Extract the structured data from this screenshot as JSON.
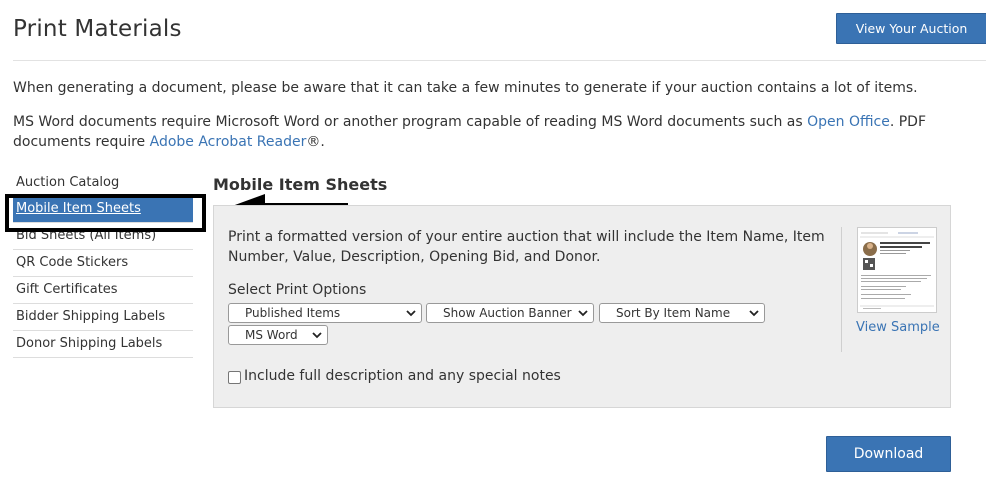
{
  "header": {
    "title": "Print Materials",
    "view_auction_label": "View Your Auction"
  },
  "intro": {
    "line1": "When generating a document, please be aware that it can take a few minutes to generate if your auction contains a lot of items.",
    "line2_pre": "MS Word documents require Microsoft Word or another program capable of reading MS Word documents such as ",
    "open_office_link": "Open Office",
    "line2_mid": ". PDF documents require ",
    "acrobat_link": "Adobe Acrobat Reader",
    "line2_post": "®."
  },
  "sidebar": {
    "items": [
      {
        "label": "Auction Catalog"
      },
      {
        "label": "Mobile Item Sheets"
      },
      {
        "label": "Bid Sheets (All Items)"
      },
      {
        "label": "QR Code Stickers"
      },
      {
        "label": "Gift Certificates"
      },
      {
        "label": "Bidder Shipping Labels"
      },
      {
        "label": "Donor Shipping Labels"
      }
    ],
    "active_index": 1
  },
  "section": {
    "title": "Mobile Item Sheets",
    "description": "Print a formatted version of your entire auction that will include the Item Name, Item Number, Value, Description, Opening Bid, and Donor.",
    "options_label": "Select Print Options",
    "options": {
      "status": "Published Items",
      "banner": "Show Auction Banner",
      "sort": "Sort By Item Name",
      "format": "MS Word"
    },
    "checkbox_label": "Include full description and any special notes",
    "checkbox_checked": false,
    "view_sample_label": "View Sample",
    "download_label": "Download"
  },
  "colors": {
    "accent": "#3a74b4",
    "panel_bg": "#eeeeee",
    "highlight": "#000000"
  },
  "icons": {
    "annotation": "arrow-left-icon",
    "select_chevron": "chevron-down-icon"
  }
}
